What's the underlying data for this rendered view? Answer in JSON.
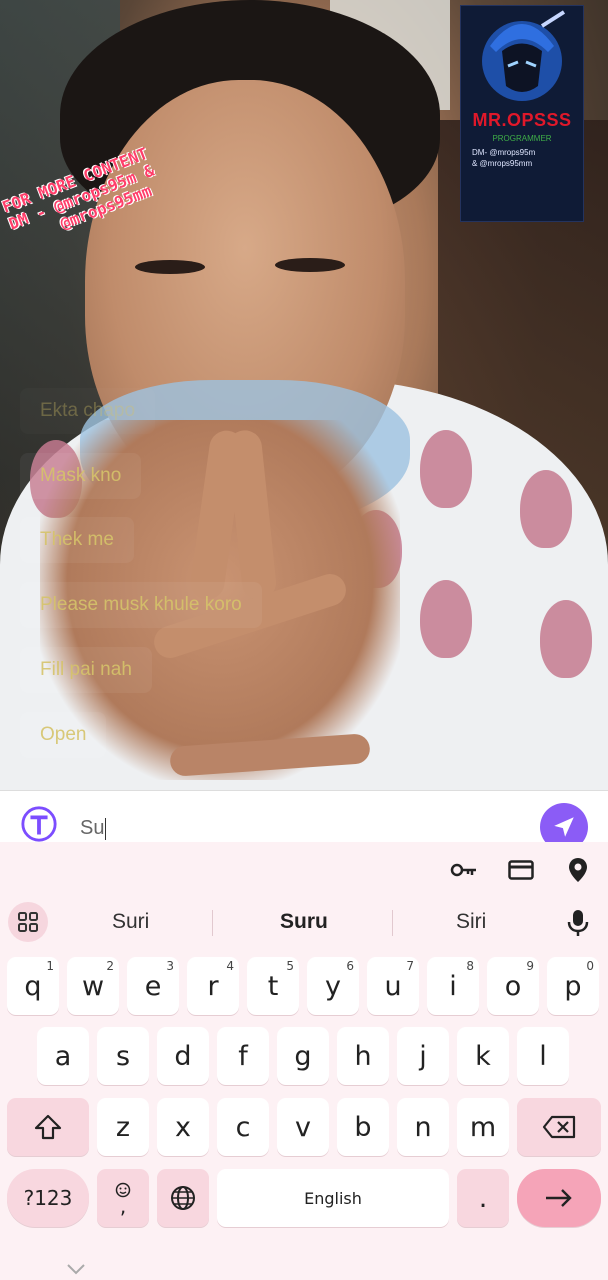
{
  "watermark": {
    "text_line1": "FOR MORE CONTENT",
    "text_line2": "DM - @mrops95m &",
    "text_line3": "@mrops95mm",
    "logo_title": "MR.OPSSS",
    "logo_subtitle": "PROGRAMMER",
    "logo_dm_line1": "DM- @mrops95m",
    "logo_dm_line2": "& @mrops95mm"
  },
  "chat": {
    "messages": [
      {
        "text": "Ekta chapo"
      },
      {
        "text": "Mask kno"
      },
      {
        "text": "Thek me"
      },
      {
        "text": "Please musk khule koro"
      },
      {
        "text": "Fill pai nah"
      },
      {
        "text": "Open"
      }
    ]
  },
  "input": {
    "value": "Su"
  },
  "keyboard": {
    "suggestions": [
      "Suri",
      "Suru",
      "Siri"
    ],
    "row1": [
      {
        "k": "q",
        "n": "1"
      },
      {
        "k": "w",
        "n": "2"
      },
      {
        "k": "e",
        "n": "3"
      },
      {
        "k": "r",
        "n": "4"
      },
      {
        "k": "t",
        "n": "5"
      },
      {
        "k": "y",
        "n": "6"
      },
      {
        "k": "u",
        "n": "7"
      },
      {
        "k": "i",
        "n": "8"
      },
      {
        "k": "o",
        "n": "9"
      },
      {
        "k": "p",
        "n": "0"
      }
    ],
    "row2": [
      "a",
      "s",
      "d",
      "f",
      "g",
      "h",
      "j",
      "k",
      "l"
    ],
    "row3": [
      "z",
      "x",
      "c",
      "v",
      "b",
      "n",
      "m"
    ],
    "symbols_label": "?123",
    "comma_label": ",",
    "space_label": "English",
    "period_label": "."
  },
  "colors": {
    "accent_send": "#8b5cf6",
    "chat_text": "#d6c46b",
    "watermark_pink": "#ff3e6a",
    "logo_red": "#e0182a"
  },
  "icons": [
    "t-logo-icon",
    "send-icon",
    "key-icon",
    "card-icon",
    "location-icon",
    "grid-icon",
    "mic-icon",
    "shift-icon",
    "backspace-icon",
    "emoji-icon",
    "globe-icon",
    "arrow-right-icon",
    "chevron-down-icon"
  ]
}
